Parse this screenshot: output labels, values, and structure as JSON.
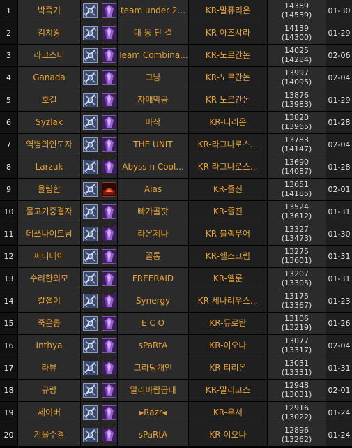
{
  "rows": [
    {
      "rank": "1",
      "name": "박죽기",
      "guild": "team under 2...",
      "server": "KR-말퓨리온",
      "score": "14389",
      "best": "(14539)",
      "date": "01-30",
      "spec_icon": "purple-crystal-icon"
    },
    {
      "rank": "2",
      "name": "김치왕",
      "guild": "대 동 단 결",
      "server": "KR-아즈샤라",
      "score": "14139",
      "best": "(14300)",
      "date": "01-29",
      "spec_icon": "purple-crystal-icon"
    },
    {
      "rank": "3",
      "name": "라코스터",
      "guild": "Team Combina...",
      "server": "KR-노르간논",
      "score": "14025",
      "best": "(14284)",
      "date": "02-06",
      "spec_icon": "purple-crystal-icon"
    },
    {
      "rank": "4",
      "name": "Ganada",
      "guild": "그냥",
      "server": "KR-노르간논",
      "score": "13997",
      "best": "(14095)",
      "date": "02-04",
      "spec_icon": "purple-crystal-icon"
    },
    {
      "rank": "5",
      "name": "호걸",
      "guild": "자매막공",
      "server": "KR-노르간논",
      "score": "13876",
      "best": "(13983)",
      "date": "01-29",
      "spec_icon": "purple-crystal-icon"
    },
    {
      "rank": "6",
      "name": "Syzlak",
      "guild": "마삭",
      "server": "KR-티리온",
      "score": "13820",
      "best": "(13965)",
      "date": "01-28",
      "spec_icon": "purple-crystal-icon"
    },
    {
      "rank": "7",
      "name": "역병의인도자",
      "guild": "THE UNIT",
      "server": "KR-라그나로스...",
      "score": "13783",
      "best": "(14147)",
      "date": "02-04",
      "spec_icon": "purple-crystal-icon"
    },
    {
      "rank": "8",
      "name": "Larzuk",
      "guild": "Abyss n Cool...",
      "server": "KR-라그나로스...",
      "score": "13690",
      "best": "(14087)",
      "date": "01-28",
      "spec_icon": "purple-crystal-icon"
    },
    {
      "rank": "9",
      "name": "올림한",
      "guild": "Aias",
      "server": "KR-줄진",
      "score": "13651",
      "best": "(14185)",
      "date": "02-01",
      "spec_icon": "red-fire-icon"
    },
    {
      "rank": "10",
      "name": "물고기중결자",
      "guild": "빠가골팟",
      "server": "KR-줄진",
      "score": "13524",
      "best": "(13612)",
      "date": "01-31",
      "spec_icon": "purple-crystal-icon"
    },
    {
      "rank": "11",
      "name": "데쓰나이트님",
      "guild": "라온제나",
      "server": "KR-블랙무어",
      "score": "13327",
      "best": "(13473)",
      "date": "01-30",
      "spec_icon": "purple-crystal-icon"
    },
    {
      "rank": "12",
      "name": "써니데이",
      "guild": "꼴통",
      "server": "KR-헬스크림",
      "score": "13275",
      "best": "(13601)",
      "date": "01-31",
      "spec_icon": "purple-crystal-icon"
    },
    {
      "rank": "13",
      "name": "수려한외모",
      "guild": "FREERAID",
      "server": "KR-엘룬",
      "score": "13207",
      "best": "(13305)",
      "date": "01-31",
      "spec_icon": "purple-crystal-icon"
    },
    {
      "rank": "14",
      "name": "칼잽이",
      "guild": "Synergy",
      "server": "KR-세나리우스...",
      "score": "13175",
      "best": "(13367)",
      "date": "01-23",
      "spec_icon": "purple-crystal-icon"
    },
    {
      "rank": "15",
      "name": "죽은콩",
      "guild": "E C O",
      "server": "KR-듀로탄",
      "score": "13106",
      "best": "(13219)",
      "date": "01-26",
      "spec_icon": "purple-crystal-icon"
    },
    {
      "rank": "16",
      "name": "Inthya",
      "guild": "sPaRtA",
      "server": "KR-이오나",
      "score": "13077",
      "best": "(13317)",
      "date": "02-04",
      "spec_icon": "purple-crystal-icon"
    },
    {
      "rank": "17",
      "name": "라뷰",
      "guild": "그라탕개인",
      "server": "KR-티리온",
      "score": "13031",
      "best": "(13331)",
      "date": "01-31",
      "spec_icon": "purple-crystal-icon"
    },
    {
      "rank": "18",
      "name": "규랑",
      "guild": "말리바람공대",
      "server": "KR-말리고스",
      "score": "12948",
      "best": "(13031)",
      "date": "02-01",
      "spec_icon": "purple-crystal-icon"
    },
    {
      "rank": "19",
      "name": "세이버",
      "guild": "▸Razr◂",
      "server": "KR-우서",
      "score": "12916",
      "best": "(13022)",
      "date": "01-24",
      "spec_icon": "purple-crystal-icon"
    },
    {
      "rank": "20",
      "name": "기율수경",
      "guild": "sPaRtA",
      "server": "KR-이오나",
      "score": "12896",
      "best": "(13262)",
      "date": "01-24",
      "spec_icon": "purple-crystal-icon"
    }
  ],
  "colors": {
    "name": "#e8a236",
    "score": "#dcdcdc",
    "cell_dark": "#1f1f1f",
    "cell_mid": "#2b2b2b"
  },
  "class_icon": "death-knight-class-icon"
}
